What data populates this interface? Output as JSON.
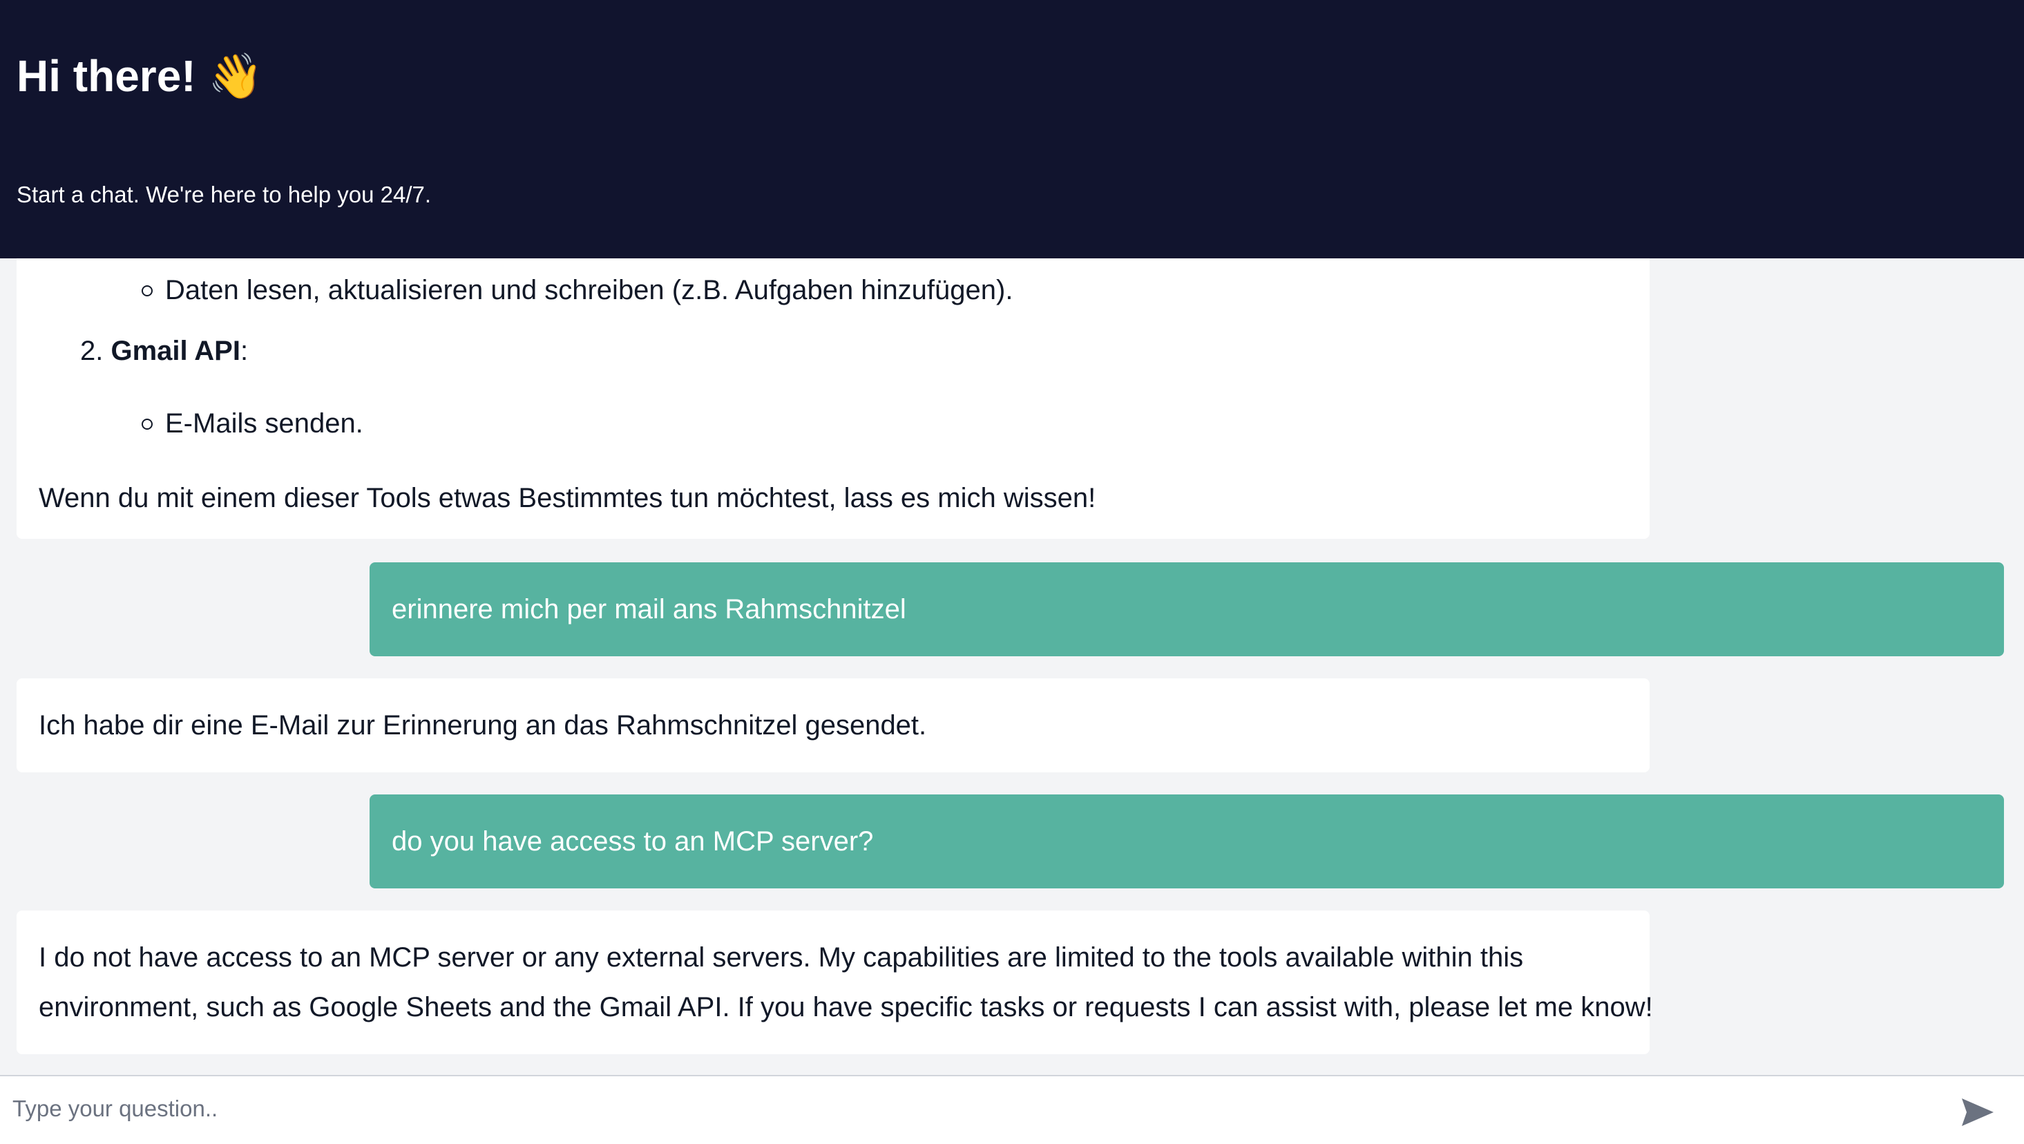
{
  "header": {
    "title": "Hi there! 👋",
    "subtitle": "Start a chat. We're here to help you 24/7."
  },
  "messages": {
    "m1": {
      "sub1": "Daten lesen, aktualisieren und schreiben (z.B. Aufgaben hinzufügen).",
      "item2_number": "2.",
      "item2_title": "Gmail API",
      "item2_colon": ":",
      "sub2": "E-Mails senden.",
      "closing": "Wenn du mit einem dieser Tools etwas Bestimmtes tun möchtest, lass es mich wissen!"
    },
    "m2": "erinnere mich per mail ans Rahmschnitzel",
    "m3": "Ich habe dir eine E-Mail zur Erinnerung an das Rahmschnitzel gesendet.",
    "m4": "do you have access to an MCP server?",
    "m5": {
      "line1": "I do not have access to an MCP server or any external servers. My capabilities are limited to the tools available within this",
      "line2": "environment, such as Google Sheets and the Gmail API. If you have specific tasks or requests I can assist with, please let me know!"
    }
  },
  "input": {
    "placeholder": "Type your question.."
  },
  "icons": {
    "send": "send-icon"
  },
  "colors": {
    "header_bg": "#11142e",
    "user_bubble": "#57b3a0",
    "page_bg": "#f3f4f6"
  }
}
